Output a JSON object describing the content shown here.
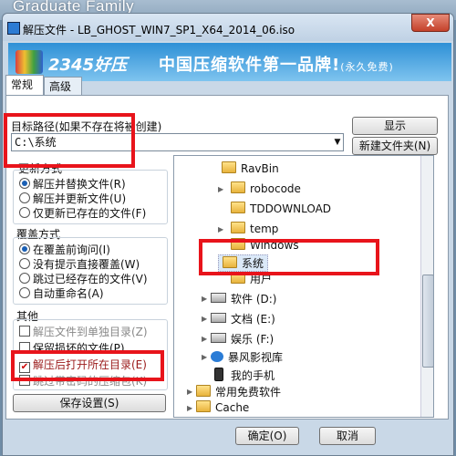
{
  "background_title": "Graduate Family",
  "window": {
    "title": "解压文件 - LB_GHOST_WIN7_SP1_X64_2014_06.iso",
    "close_glyph": "X"
  },
  "banner": {
    "logo": "2345好压",
    "slogan": "中国压缩软件第一品牌!",
    "slogan_note": "(永久免费)"
  },
  "tabs": [
    "常规",
    "高级"
  ],
  "target_path": {
    "label": "目标路径(如果不存在将被创建)",
    "value": "C:\\系统",
    "show_button": "显示",
    "new_folder_button": "新建文件夹(N)"
  },
  "update_mode": {
    "title": "更新方式",
    "options": [
      "解压并替换文件(R)",
      "解压并更新文件(U)",
      "仅更新已存在的文件(F)"
    ],
    "selected": 0
  },
  "overwrite_mode": {
    "title": "覆盖方式",
    "options": [
      "在覆盖前询问(I)",
      "没有提示直接覆盖(W)",
      "跳过已经存在的文件(V)",
      "自动重命名(A)"
    ],
    "selected": 0
  },
  "misc": {
    "title": "其他",
    "options": [
      {
        "label": "解压文件到单独目录(Z)",
        "checked": false,
        "disabled": true
      },
      {
        "label": "保留损坏的文件(P)",
        "checked": false,
        "disabled": false
      },
      {
        "label": "解压后打开所在目录(E)",
        "checked": true,
        "disabled": false
      },
      {
        "label": "跳过带密码的压缩包(K)",
        "checked": false,
        "disabled": true
      }
    ]
  },
  "save_settings_button": "保存设置(S)",
  "tree": {
    "items": [
      {
        "label": "RavBin",
        "icon": "folder-icon"
      },
      {
        "label": "robocode",
        "icon": "folder-icon"
      },
      {
        "label": "TDDOWNLOAD",
        "icon": "folder-icon"
      },
      {
        "label": "temp",
        "icon": "folder-icon"
      },
      {
        "label": "Windows",
        "icon": "folder-icon"
      },
      {
        "label": "系统",
        "icon": "folder-icon"
      },
      {
        "label": "用户",
        "icon": "folder-icon"
      },
      {
        "label": "软件 (D:)",
        "icon": "drive-icon"
      },
      {
        "label": "文档 (E:)",
        "icon": "drive-icon"
      },
      {
        "label": "娱乐 (F:)",
        "icon": "drive-icon"
      },
      {
        "label": "暴风影视库",
        "icon": "video-library-icon"
      },
      {
        "label": "我的手机",
        "icon": "phone-icon"
      },
      {
        "label": "常用免费软件",
        "icon": "folder-icon"
      },
      {
        "label": "Cache",
        "icon": "folder-icon"
      }
    ],
    "selected": "系统"
  },
  "footer": {
    "ok_button": "确定(O)",
    "cancel_button": "取消"
  },
  "highlight_color": "#e8141b"
}
